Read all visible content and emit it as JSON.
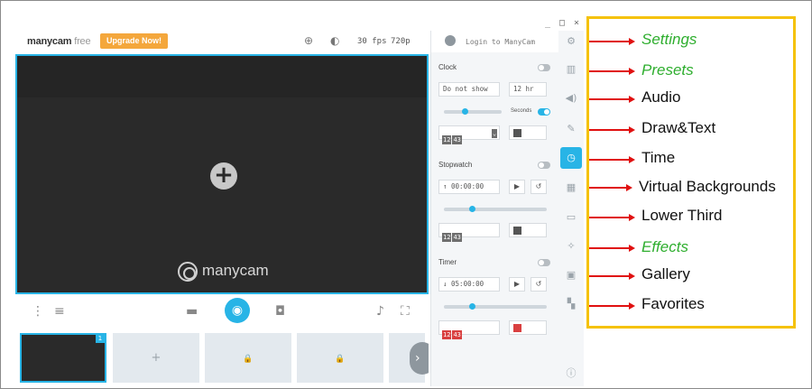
{
  "app": {
    "logo_bold": "manycam",
    "logo_suffix": " free",
    "upgrade_label": "Upgrade Now!",
    "fps": "30 fps",
    "resolution": "720p",
    "login_label": "Login to ManyCam",
    "window_controls": [
      "_",
      "□",
      "×"
    ]
  },
  "preview": {
    "watermark": "manycam",
    "add_source_symbol": "+"
  },
  "thumbnails": [
    {
      "state": "active",
      "badge": "1"
    },
    {
      "state": "add",
      "symbol": "+"
    },
    {
      "state": "locked",
      "symbol": "🔒"
    },
    {
      "state": "locked",
      "symbol": "🔒"
    }
  ],
  "clock": {
    "title": "Clock",
    "show_select": "Do not show",
    "hour_select": "12 hr",
    "seconds_label": "Seconds",
    "format": [
      "12",
      "43"
    ]
  },
  "stopwatch": {
    "title": "Stopwatch",
    "time": "00:00:00",
    "format": [
      "12",
      "43"
    ]
  },
  "timer": {
    "title": "Timer",
    "time": "05:00:00",
    "format": [
      "12",
      "43"
    ],
    "color": "#d94040"
  },
  "annotations": [
    {
      "label": "Settings",
      "style": "green"
    },
    {
      "label": "Presets",
      "style": "green"
    },
    {
      "label": "Audio",
      "style": "normal"
    },
    {
      "label": "Draw&Text",
      "style": "normal"
    },
    {
      "label": "Time",
      "style": "normal"
    },
    {
      "label": "Virtual Backgrounds",
      "style": "normal"
    },
    {
      "label": "Lower Third",
      "style": "normal"
    },
    {
      "label": "Effects",
      "style": "green"
    },
    {
      "label": "Gallery",
      "style": "normal"
    },
    {
      "label": "Favorites",
      "style": "normal"
    }
  ],
  "colors": {
    "accent": "#28b4e6",
    "upgrade": "#f4a73c",
    "annotation_border": "#f5c20a",
    "arrow": "#e01010",
    "green_label": "#2eae2e"
  }
}
